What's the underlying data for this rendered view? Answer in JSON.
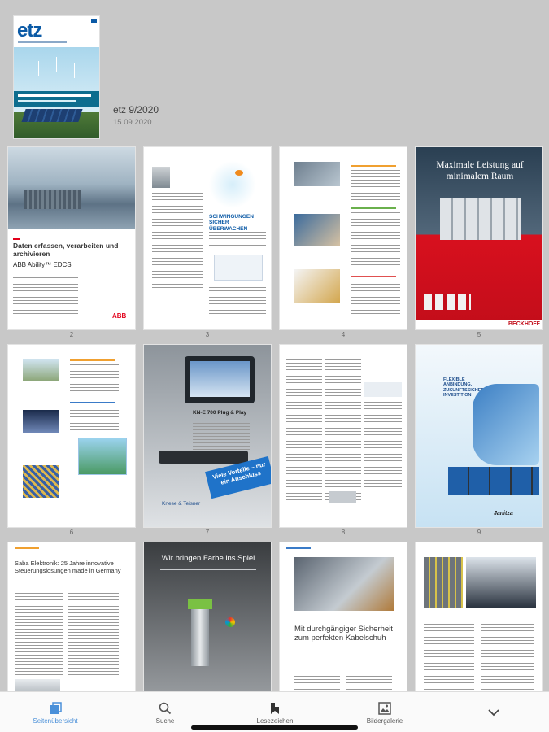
{
  "issue": {
    "cover_logo": "etz",
    "title": "etz 9/2020",
    "date": "15.09.2020"
  },
  "pages": [
    {
      "num": "2",
      "headline": "Daten erfassen, verarbeiten und archivieren",
      "subline": "ABB Ability™ EDCS",
      "brand": "ABB"
    },
    {
      "num": "3",
      "headline": "SCHWINGUNGEN SICHER ÜBERWACHEN",
      "brand": ""
    },
    {
      "num": "4",
      "headline": "",
      "brand": ""
    },
    {
      "num": "5",
      "headline": "Maximale Leistung auf minimalem Raum",
      "brand": "BECKHOFF"
    },
    {
      "num": "6",
      "headline": "",
      "brand": ""
    },
    {
      "num": "7",
      "headline": "Viele Vorteile – nur ein Anschluss",
      "subline": "KN-E 700 Plug & Play",
      "brand": "Knese & Teisner"
    },
    {
      "num": "8",
      "headline": "",
      "brand": ""
    },
    {
      "num": "9",
      "headline": "FLEXIBLE ANBINDUNG, ZUKUNFTSSICHERE INVESTITION",
      "brand": "Janitza"
    },
    {
      "num": "",
      "headline": "Saba Elektronik: 25 Jahre innovative Steuerungslösungen made in Germany",
      "brand": ""
    },
    {
      "num": "",
      "headline": "Wir bringen Farbe ins Spiel",
      "brand": ""
    },
    {
      "num": "",
      "headline": "Mit durchgängiger Sicherheit zum perfekten Kabelschuh",
      "brand": ""
    },
    {
      "num": "",
      "headline": "",
      "brand": ""
    }
  ],
  "tabbar": {
    "tabs": [
      {
        "label": "Seitenübersicht",
        "icon": "pages-icon",
        "active": true
      },
      {
        "label": "Suche",
        "icon": "search-icon",
        "active": false
      },
      {
        "label": "Lesezeichen",
        "icon": "bookmark-icon",
        "active": false
      },
      {
        "label": "Bildergalerie",
        "icon": "gallery-icon",
        "active": false
      }
    ],
    "more_icon": "chevron-down-icon"
  },
  "colors": {
    "accent": "#4a90d9",
    "background": "#c8c8c8",
    "abb_red": "#e2001a",
    "beckhoff_red": "#d8101e"
  }
}
